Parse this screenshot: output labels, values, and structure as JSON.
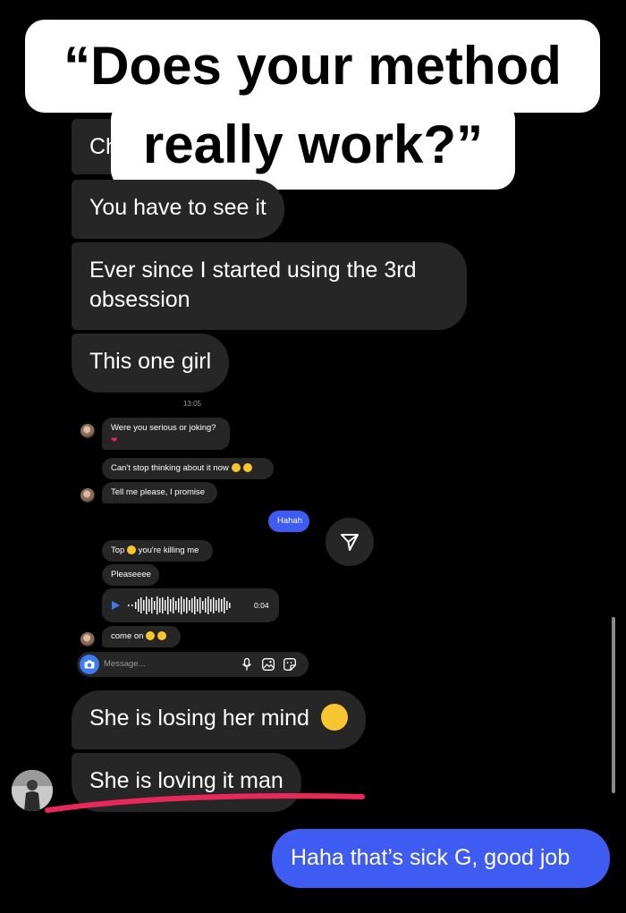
{
  "caption": {
    "line1": "“Does your method",
    "line2": "really work?”"
  },
  "chat": {
    "hidden_partial_label": "Ch",
    "messages_top": [
      "You have to see it",
      "Ever since I started using the 3rd obsession",
      "This one girl"
    ],
    "messages_bottom": [
      "She is losing her mind",
      "She is loving it man"
    ],
    "sent_message": "Haha that’s sick G, good job"
  },
  "inner_screenshot": {
    "timestamp": "13:05",
    "msg1": "Were you serious or joking?",
    "msg2": "Can't stop thinking about it now",
    "msg3": "Tell me please, I promise",
    "sent": "Hahah",
    "msg4_prefix": "Top",
    "msg4_suffix": "you're killing me",
    "msg5": "Pleaseeee",
    "voice_duration": "0:04",
    "msg6": "come on",
    "input_placeholder": "Message...",
    "icons": [
      "camera-icon",
      "microphone-icon",
      "image-icon",
      "sticker-icon"
    ]
  },
  "colors": {
    "background": "#000000",
    "bubble": "#262626",
    "sent_bubble": "#3e5bf2",
    "underline": "#e8275a",
    "caption_bg": "#ffffff"
  }
}
